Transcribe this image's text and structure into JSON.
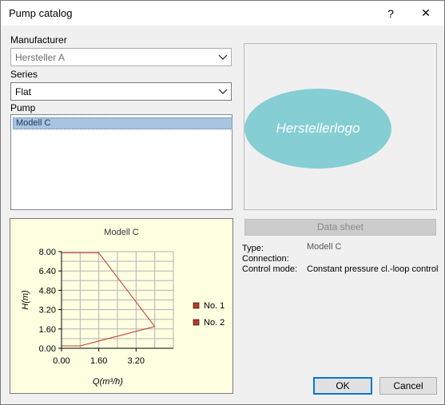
{
  "window": {
    "title": "Pump catalog",
    "help_glyph": "?",
    "close_glyph": "✕"
  },
  "manufacturer": {
    "label": "Manufacturer",
    "value": "Hersteller A"
  },
  "series": {
    "label": "Series",
    "value": "Flat"
  },
  "pump": {
    "label": "Pump",
    "items": [
      "Modell C"
    ]
  },
  "logo": {
    "text": "Herstellerlogo",
    "color": "#85ced3"
  },
  "datasheet": {
    "label": "Data sheet"
  },
  "info": {
    "type_key": "Type:",
    "type_val": "Modell C",
    "connection_key": "Connection:",
    "connection_val": "",
    "control_key": "Control mode:",
    "control_val": "Constant pressure cl.-loop control"
  },
  "chart_data": {
    "type": "line",
    "title": "Modell C",
    "xlabel": "Q(m³/h)",
    "ylabel": "H(m)",
    "xlim": [
      0,
      4.8
    ],
    "ylim": [
      0,
      8.0
    ],
    "x_ticks": [
      "0.00",
      "1.60",
      "3.20"
    ],
    "y_ticks": [
      "0.00",
      "1.60",
      "3.20",
      "4.80",
      "6.40",
      "8.00"
    ],
    "grid": true,
    "legend_position": "right",
    "background": "#ffffe2",
    "series": [
      {
        "name": "No. 1",
        "color": "#c0392b",
        "x": [
          0.0,
          1.6,
          4.0
        ],
        "y": [
          7.9,
          7.9,
          1.8
        ]
      },
      {
        "name": "No. 2",
        "color": "#c0392b",
        "x": [
          0.0,
          0.8,
          4.0
        ],
        "y": [
          0.2,
          0.2,
          1.8
        ]
      }
    ]
  },
  "buttons": {
    "ok": "OK",
    "cancel": "Cancel"
  }
}
